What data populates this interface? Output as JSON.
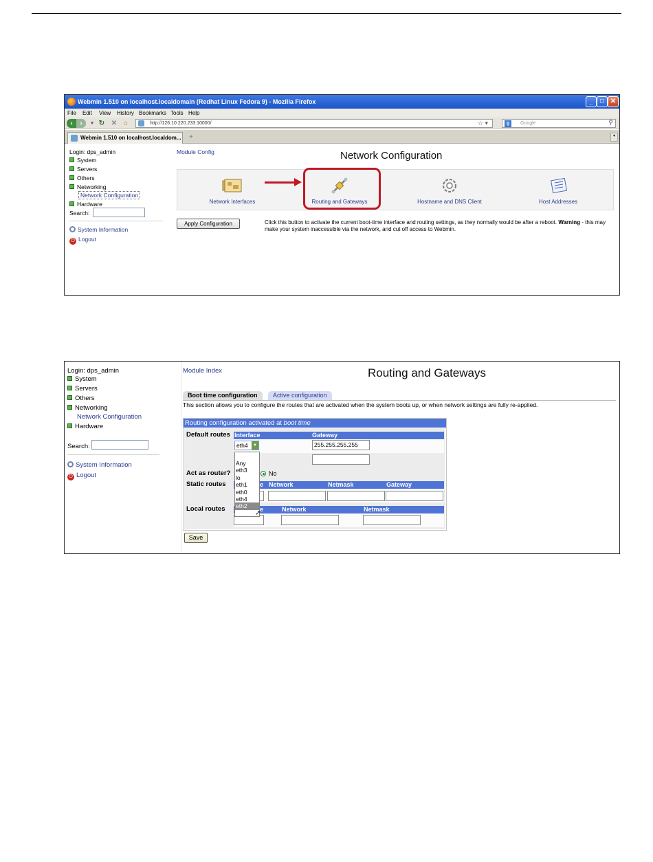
{
  "shot1": {
    "window_title": "Webmin 1.510 on localhost.localdomain (Redhat Linux Fedora 9) - Mozilla Firefox",
    "menu": [
      "File",
      "Edit",
      "View",
      "History",
      "Bookmarks",
      "Tools",
      "Help"
    ],
    "url": "http://126.10.220.233:10000/",
    "search_placeholder": "Google",
    "tab_title": "Webmin 1.510 on localhost.localdom...",
    "newtab_label": "+",
    "sidebar": {
      "login": "Login: dps_admin",
      "items": [
        "System",
        "Servers",
        "Others",
        "Networking"
      ],
      "sub_item": "Network Configuration",
      "last_item": "Hardware",
      "search_label": "Search:",
      "system_information": "System Information",
      "logout": "Logout"
    },
    "module_config": "Module Config",
    "page_title": "Network Configuration",
    "modules": [
      {
        "label": "Network Interfaces",
        "icon": "network-interfaces-icon"
      },
      {
        "label": "Routing and Gateways",
        "icon": "routing-gateways-icon"
      },
      {
        "label": "Hostname and DNS Client",
        "icon": "gear-icon"
      },
      {
        "label": "Host Addresses",
        "icon": "host-addresses-icon"
      }
    ],
    "apply_button": "Apply Configuration",
    "apply_text_1": "Click this button to activate the current boot-time interface and routing settings, as they normally would be after a reboot. ",
    "apply_text_warning": "Warning",
    "apply_text_2": " - this may make your system inaccessible via the network, and cut off access to Webmin.",
    "colors": {
      "highlight": "#c01824",
      "titlebar": "#2a62d6"
    }
  },
  "shot2": {
    "sidebar": {
      "login": "Login: dps_admin",
      "items": [
        "System",
        "Servers",
        "Others",
        "Networking"
      ],
      "sub_item": "Network Configuration",
      "last_item": "Hardware",
      "search_label": "Search:",
      "system_information": "System Information",
      "logout": "Logout"
    },
    "module_index": "Module Index",
    "page_title": "Routing and Gateways",
    "tabs": [
      "Boot time configuration",
      "Active configuration"
    ],
    "section_description": "This section allows you to configure the routes that are activated when the system boots up, or when network settings are fully re-applied.",
    "config_heading_prefix": "Routing configuration activated at ",
    "config_heading_emph": "boot time",
    "default_routes": {
      "label": "Default routes",
      "col_interface": "Interface",
      "col_gateway": "Gateway",
      "selected_interface": "eth4",
      "gateway_value": "255.255.255.255"
    },
    "interface_options": [
      "Any",
      "eth3",
      "lo",
      "eth1",
      "eth0",
      "eth4",
      "eth2"
    ],
    "highlighted_option": "eth2",
    "act_as_router": {
      "label": "Act as router?",
      "no_label": "No"
    },
    "static_routes": {
      "label": "Static routes",
      "col_interface_tail": "e",
      "col_network": "Network",
      "col_netmask": "Netmask",
      "col_gateway": "Gateway"
    },
    "local_routes": {
      "label": "Local routes",
      "col_interface_tail": "e",
      "col_network": "Network",
      "col_netmask": "Netmask"
    },
    "save_button": "Save",
    "colors": {
      "table_header": "#4f74d5",
      "select_arrow": "#6d9b4a"
    }
  }
}
